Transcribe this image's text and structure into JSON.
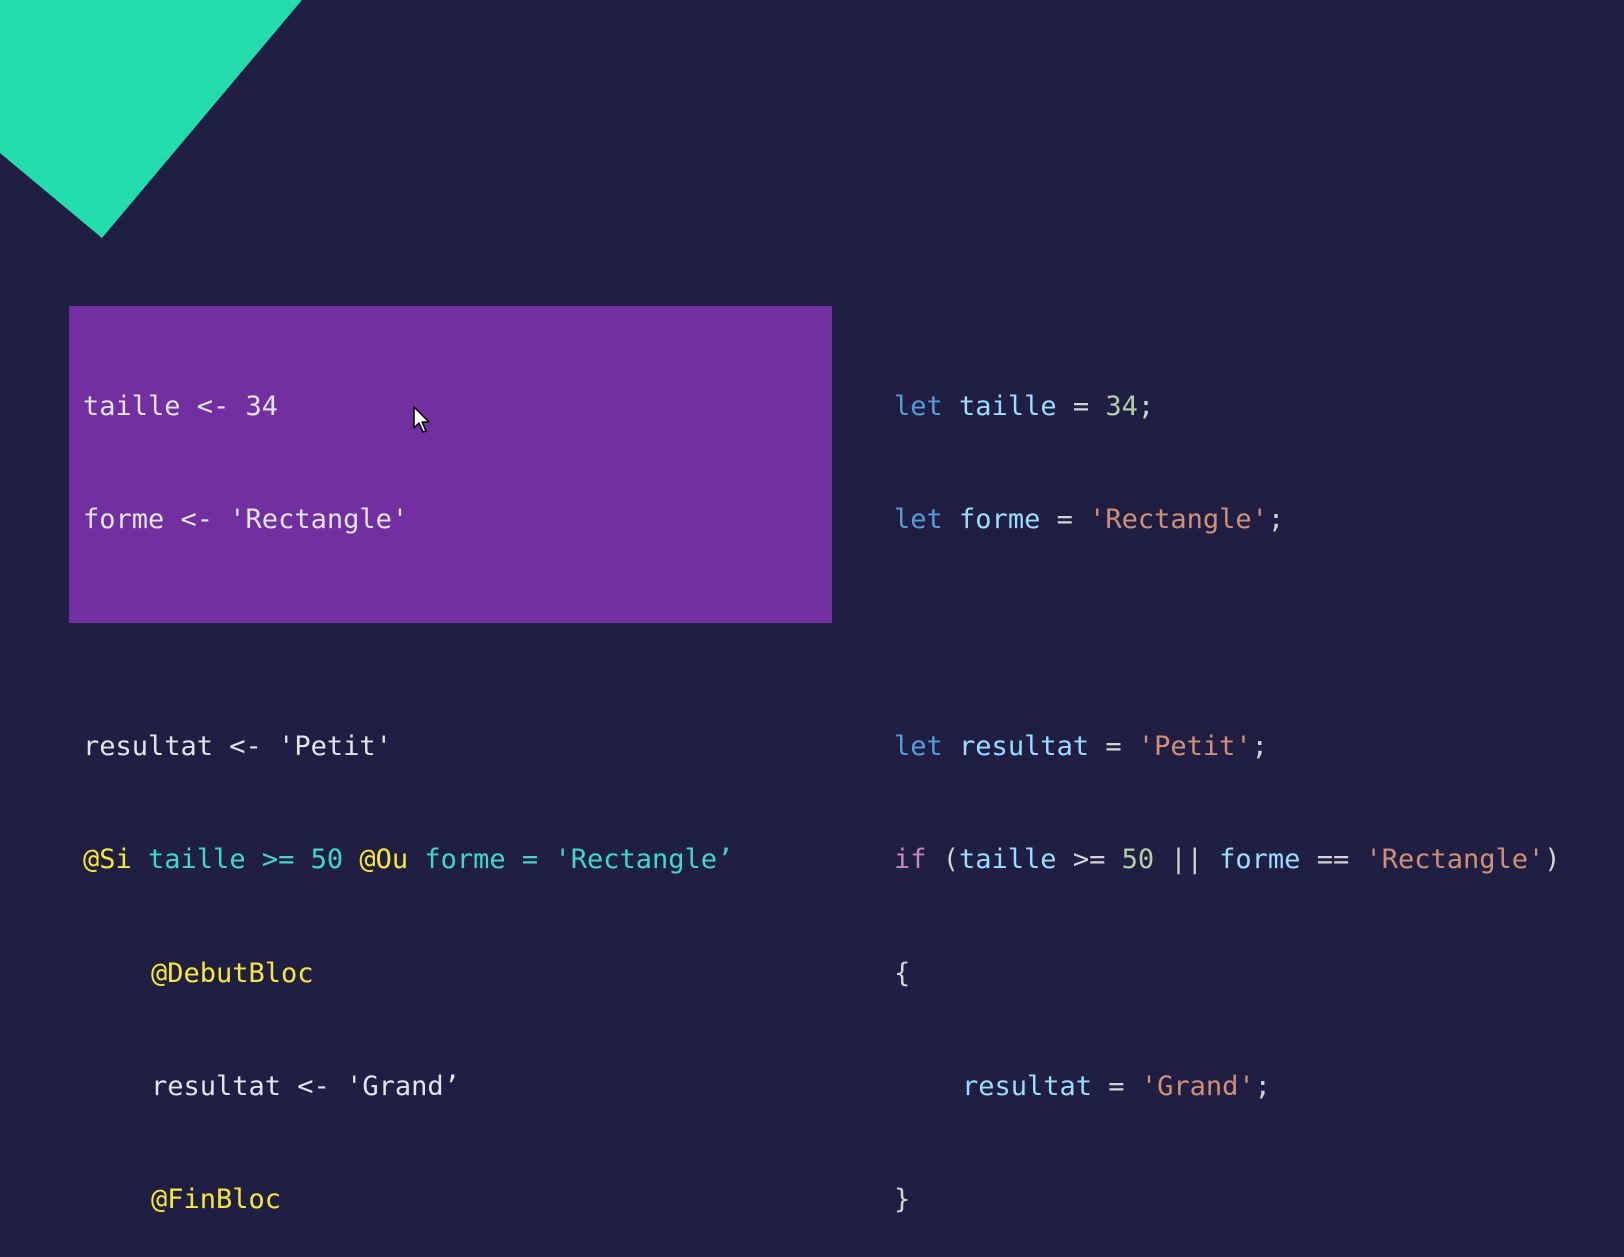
{
  "colors": {
    "background": "#201f43",
    "accent_shape": "#23dcab",
    "pseudo_panel": "#712f9f",
    "pseudo_keyword": "#f5e83a",
    "pseudo_condition": "#3fd8c6",
    "js_keyword": "#569cd6",
    "js_control": "#c586c0",
    "js_variable": "#9cdcfe",
    "js_number": "#b5cea8",
    "js_string": "#ce9178"
  },
  "pseudo": {
    "l1": "taille <- 34",
    "l2": "forme <- 'Rectangle'",
    "l4": "resultat <- 'Petit'",
    "l5_kw1": "@Si",
    "l5_cond1": " taille >= 50 ",
    "l5_kw2": "@Ou",
    "l5_cond2": " forme = 'Rectangle’",
    "l6": "@DebutBloc",
    "l7": "resultat <- 'Grand’",
    "l8": "@FinBloc"
  },
  "js": {
    "let": "let",
    "l1_var": "taille",
    "l1_eq": " = ",
    "l1_num": "34",
    "semi": ";",
    "l2_var": "forme",
    "l2_str": "'Rectangle'",
    "l4_var": "resultat",
    "l4_str": "'Petit'",
    "l5_if": "if",
    "l5_open": " (",
    "l5_var1": "taille",
    "l5_op1": " >= ",
    "l5_num": "50",
    "l5_or": " || ",
    "l5_var2": "forme",
    "l5_op2": " == ",
    "l5_str": "'Rectangle'",
    "l5_close": ")",
    "brace_open": "{",
    "l7_var": "resultat",
    "l7_str": "'Grand'",
    "brace_close": "}"
  }
}
